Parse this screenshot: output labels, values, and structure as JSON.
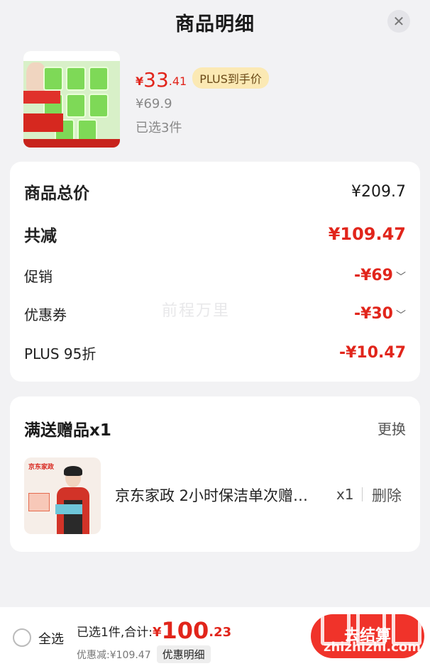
{
  "header": {
    "title": "商品明细",
    "close_icon": "close-icon"
  },
  "product": {
    "price_symbol": "¥",
    "price_int": "33",
    "price_dec": ".41",
    "plus_badge": "PLUS到手价",
    "original_price": "¥69.9",
    "selected_count": "已选3件"
  },
  "summary": {
    "total_label": "商品总价",
    "total_value": "¥209.7",
    "reduction_label": "共减",
    "reduction_value": "¥109.47",
    "promo_label": "促销",
    "promo_value": "-¥69",
    "coupon_label": "优惠券",
    "coupon_value": "-¥30",
    "plus_label": "PLUS 95折",
    "plus_value": "-¥10.47",
    "watermark": "前程万里"
  },
  "gift": {
    "title": "满送赠品x1",
    "change": "更换",
    "brand": "京东家政",
    "name": "京东家政 2小时保洁单次赠…",
    "qty": "x1",
    "delete": "删除"
  },
  "bottom_bar": {
    "select_all": "全选",
    "selected_text": "已选1件,合计:",
    "total_symbol": "¥",
    "total_int": "100",
    "total_dec": ".23",
    "discount_text": "优惠减:¥109.47",
    "detail_button": "优惠明细",
    "checkout_button": "去结算",
    "watermark_domain": "zhizhizhi.com"
  },
  "colors": {
    "accent_red": "#e1251b",
    "plus_gold": "#fbe9b4",
    "background": "#f2f2f4"
  }
}
